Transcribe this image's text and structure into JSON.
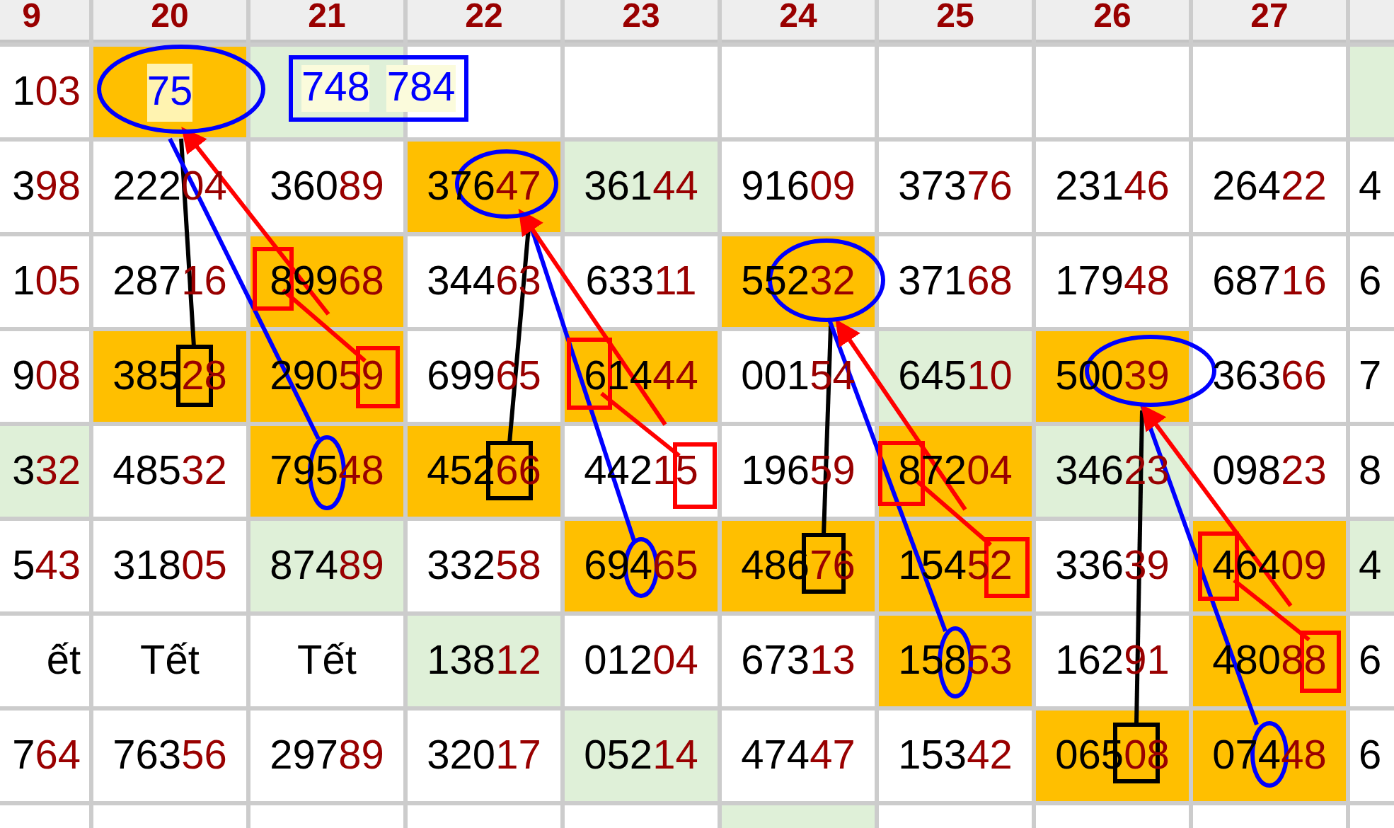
{
  "columns": [
    "9",
    "20",
    "21",
    "22",
    "23",
    "24",
    "25",
    "26",
    "27",
    ""
  ],
  "rows": [
    {
      "cells": [
        {
          "kind": "number",
          "text": "103",
          "color": "#ffffff"
        },
        {
          "kind": "pick",
          "text": "75",
          "color": "#ffbf00"
        },
        {
          "kind": "pair",
          "values": [
            "748",
            "784"
          ],
          "color": "#dff0d8"
        },
        {
          "kind": "blank",
          "color": "#ffffff"
        },
        {
          "kind": "blank",
          "color": "#ffffff"
        },
        {
          "kind": "blank",
          "color": "#ffffff"
        },
        {
          "kind": "blank",
          "color": "#ffffff"
        },
        {
          "kind": "blank",
          "color": "#ffffff"
        },
        {
          "kind": "blank",
          "color": "#ffffff"
        },
        {
          "kind": "blank",
          "color": "#dff0d8"
        }
      ]
    },
    {
      "cells": [
        {
          "kind": "number",
          "text": "398",
          "color": "#ffffff"
        },
        {
          "kind": "number",
          "text": "22204",
          "color": "#ffffff"
        },
        {
          "kind": "number",
          "text": "36089",
          "color": "#ffffff"
        },
        {
          "kind": "number",
          "text": "37647",
          "color": "#ffbf00"
        },
        {
          "kind": "number",
          "text": "36144",
          "color": "#dff0d8"
        },
        {
          "kind": "number",
          "text": "91609",
          "color": "#ffffff"
        },
        {
          "kind": "number",
          "text": "37376",
          "color": "#ffffff"
        },
        {
          "kind": "number",
          "text": "23146",
          "color": "#ffffff"
        },
        {
          "kind": "number",
          "text": "26422",
          "color": "#ffffff"
        },
        {
          "kind": "plain",
          "text": "4",
          "color": "#ffffff"
        }
      ]
    },
    {
      "cells": [
        {
          "kind": "number",
          "text": "105",
          "color": "#ffffff"
        },
        {
          "kind": "number",
          "text": "28716",
          "color": "#ffffff"
        },
        {
          "kind": "number",
          "text": "89968",
          "color": "#ffbf00"
        },
        {
          "kind": "number",
          "text": "34463",
          "color": "#ffffff"
        },
        {
          "kind": "number",
          "text": "63311",
          "color": "#ffffff"
        },
        {
          "kind": "number",
          "text": "55232",
          "color": "#ffbf00"
        },
        {
          "kind": "number",
          "text": "37168",
          "color": "#ffffff"
        },
        {
          "kind": "number",
          "text": "17948",
          "color": "#ffffff"
        },
        {
          "kind": "number",
          "text": "68716",
          "color": "#ffffff"
        },
        {
          "kind": "plain",
          "text": "6",
          "color": "#ffffff"
        }
      ]
    },
    {
      "cells": [
        {
          "kind": "number",
          "text": "908",
          "color": "#ffffff"
        },
        {
          "kind": "number",
          "text": "38528",
          "color": "#ffbf00"
        },
        {
          "kind": "number",
          "text": "29059",
          "color": "#ffbf00"
        },
        {
          "kind": "number",
          "text": "69965",
          "color": "#ffffff"
        },
        {
          "kind": "number",
          "text": "61444",
          "color": "#ffbf00"
        },
        {
          "kind": "number",
          "text": "00154",
          "color": "#ffffff"
        },
        {
          "kind": "number",
          "text": "64510",
          "color": "#dff0d8"
        },
        {
          "kind": "number",
          "text": "50039",
          "color": "#ffbf00"
        },
        {
          "kind": "number",
          "text": "36366",
          "color": "#ffffff"
        },
        {
          "kind": "plain",
          "text": "7",
          "color": "#ffffff"
        }
      ]
    },
    {
      "cells": [
        {
          "kind": "number",
          "text": "332",
          "color": "#dff0d8"
        },
        {
          "kind": "number",
          "text": "48532",
          "color": "#ffffff"
        },
        {
          "kind": "number",
          "text": "79548",
          "color": "#ffbf00"
        },
        {
          "kind": "number",
          "text": "45266",
          "color": "#ffbf00"
        },
        {
          "kind": "number",
          "text": "44215",
          "color": "#ffffff"
        },
        {
          "kind": "number",
          "text": "19659",
          "color": "#ffffff"
        },
        {
          "kind": "number",
          "text": "87204",
          "color": "#ffbf00"
        },
        {
          "kind": "number",
          "text": "34623",
          "color": "#dff0d8"
        },
        {
          "kind": "number",
          "text": "09823",
          "color": "#ffffff"
        },
        {
          "kind": "plain",
          "text": "8",
          "color": "#ffffff"
        }
      ]
    },
    {
      "cells": [
        {
          "kind": "number",
          "text": "543",
          "color": "#ffffff"
        },
        {
          "kind": "number",
          "text": "31805",
          "color": "#ffffff"
        },
        {
          "kind": "number",
          "text": "87489",
          "color": "#dff0d8"
        },
        {
          "kind": "number",
          "text": "33258",
          "color": "#ffffff"
        },
        {
          "kind": "number",
          "text": "69465",
          "color": "#ffbf00"
        },
        {
          "kind": "number",
          "text": "48676",
          "color": "#ffbf00"
        },
        {
          "kind": "number",
          "text": "15452",
          "color": "#ffbf00"
        },
        {
          "kind": "number",
          "text": "33639",
          "color": "#ffffff"
        },
        {
          "kind": "number",
          "text": "46409",
          "color": "#ffbf00"
        },
        {
          "kind": "plain",
          "text": "4",
          "color": "#dff0d8"
        }
      ]
    },
    {
      "cells": [
        {
          "kind": "plain",
          "text": "ết",
          "color": "#ffffff"
        },
        {
          "kind": "plain",
          "text": "Tết",
          "color": "#ffffff"
        },
        {
          "kind": "plain",
          "text": "Tết",
          "color": "#ffffff"
        },
        {
          "kind": "number",
          "text": "13812",
          "color": "#dff0d8"
        },
        {
          "kind": "number",
          "text": "01204",
          "color": "#ffffff"
        },
        {
          "kind": "number",
          "text": "67313",
          "color": "#ffffff"
        },
        {
          "kind": "number",
          "text": "15853",
          "color": "#ffbf00"
        },
        {
          "kind": "number",
          "text": "16291",
          "color": "#ffffff"
        },
        {
          "kind": "number",
          "text": "48088",
          "color": "#ffbf00"
        },
        {
          "kind": "plain",
          "text": "6",
          "color": "#ffffff"
        }
      ]
    },
    {
      "cells": [
        {
          "kind": "number",
          "text": "764",
          "color": "#ffffff"
        },
        {
          "kind": "number",
          "text": "76356",
          "color": "#ffffff"
        },
        {
          "kind": "number",
          "text": "29789",
          "color": "#ffffff"
        },
        {
          "kind": "number",
          "text": "32017",
          "color": "#ffffff"
        },
        {
          "kind": "number",
          "text": "05214",
          "color": "#dff0d8"
        },
        {
          "kind": "number",
          "text": "47447",
          "color": "#ffffff"
        },
        {
          "kind": "number",
          "text": "15342",
          "color": "#ffffff"
        },
        {
          "kind": "number",
          "text": "06508",
          "color": "#ffbf00"
        },
        {
          "kind": "number",
          "text": "07448",
          "color": "#ffbf00"
        },
        {
          "kind": "plain",
          "text": "6",
          "color": "#ffffff"
        }
      ]
    },
    {
      "cells": [
        {
          "kind": "blank",
          "color": "#ffffff"
        },
        {
          "kind": "blank",
          "color": "#ffffff"
        },
        {
          "kind": "blank",
          "color": "#ffffff"
        },
        {
          "kind": "blank",
          "color": "#ffffff"
        },
        {
          "kind": "blank",
          "color": "#ffffff"
        },
        {
          "kind": "blank",
          "color": "#dff0d8"
        },
        {
          "kind": "blank",
          "color": "#ffffff"
        },
        {
          "kind": "blank",
          "color": "#ffffff"
        },
        {
          "kind": "blank",
          "color": "#ffffff"
        },
        {
          "kind": "blank",
          "color": "#ffffff"
        }
      ]
    }
  ]
}
